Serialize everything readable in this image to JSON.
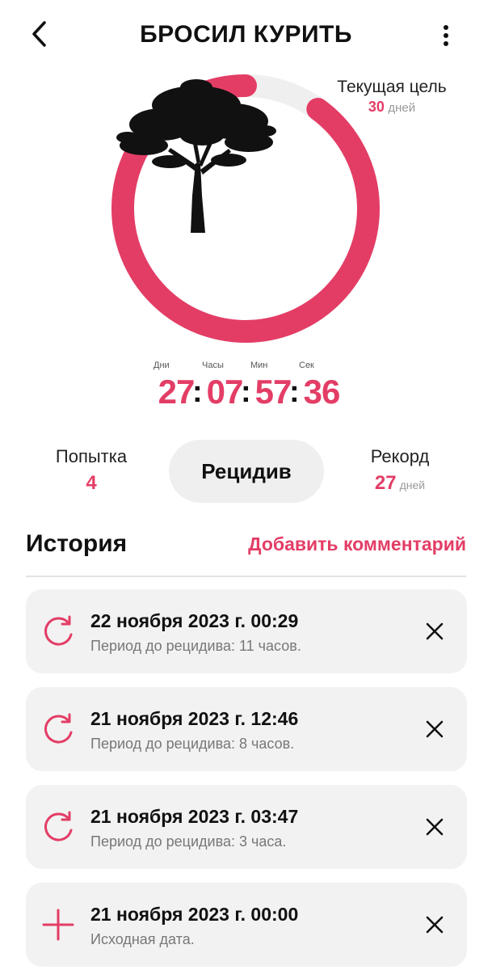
{
  "header": {
    "title": "БРОСИЛ КУРИТЬ",
    "back_icon": "chevron-left-icon",
    "menu_icon": "more-vertical-icon"
  },
  "progress": {
    "fraction": 0.9,
    "accent_color": "#e33d66",
    "track_color": "#efefef",
    "image": "tree-silhouette"
  },
  "goal": {
    "label": "Текущая цель",
    "value": "30",
    "unit": "дней"
  },
  "timer": {
    "days_label": "Дни",
    "days": "27",
    "hours_label": "Часы",
    "hours": "07",
    "minutes_label": "Мин",
    "minutes": "57",
    "seconds_label": "Сек",
    "seconds": "36",
    "separator": ":"
  },
  "stats": {
    "attempt_label": "Попытка",
    "attempt_value": "4",
    "relapse_button": "Рецидив",
    "record_label": "Рекорд",
    "record_value": "27",
    "record_unit": "дней"
  },
  "history": {
    "title": "История",
    "add_comment": "Добавить комментарий",
    "items": [
      {
        "icon": "refresh-icon",
        "date": "22 ноября 2023 г. 00:29",
        "subtitle": "Период до рецидива: 11 часов."
      },
      {
        "icon": "refresh-icon",
        "date": "21 ноября 2023 г. 12:46",
        "subtitle": "Период до рецидива: 8 часов."
      },
      {
        "icon": "refresh-icon",
        "date": "21 ноября 2023 г. 03:47",
        "subtitle": "Период до рецидива: 3 часа."
      },
      {
        "icon": "plus-icon",
        "date": "21 ноября 2023 г. 00:00",
        "subtitle": "Исходная дата."
      }
    ]
  }
}
